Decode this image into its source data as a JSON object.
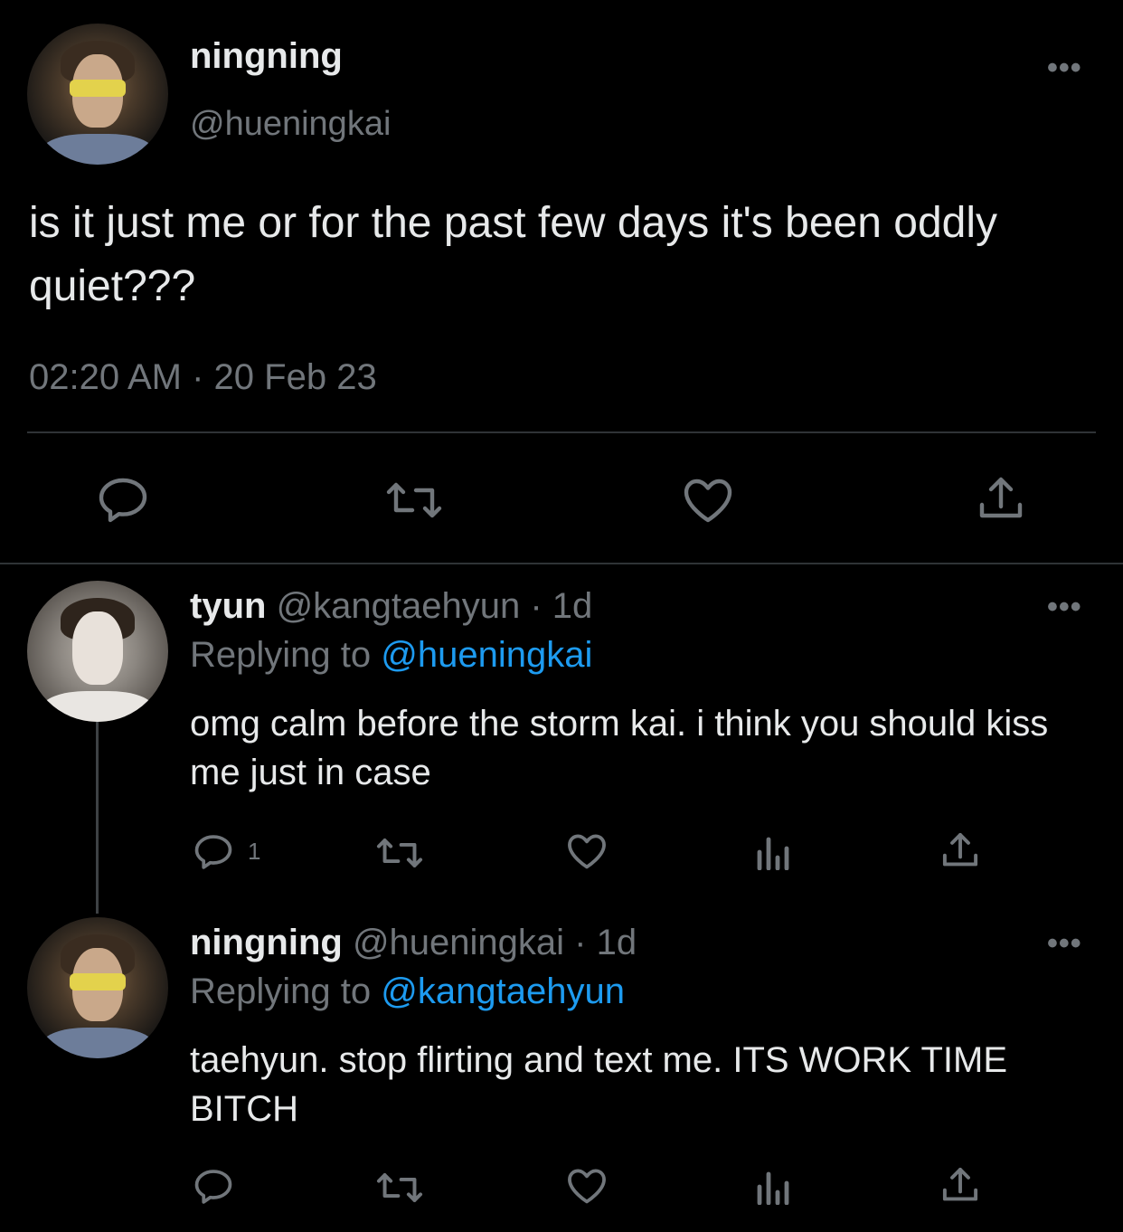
{
  "main_tweet": {
    "display_name": "ningning",
    "handle": "@hueningkai",
    "more": "•••",
    "text": "is it just me or for the past few days it's been oddly quiet???",
    "timestamp": "02:20 AM · 20 Feb 23"
  },
  "reply1": {
    "display_name": "tyun",
    "handle_time": "@kangtaehyun · 1d",
    "more": "•••",
    "replying_prefix": "Replying to",
    "replying_to": "@hueningkai",
    "text": "omg calm before the storm kai. i think you should kiss me just in case",
    "reply_count": "1"
  },
  "reply2": {
    "display_name": "ningning",
    "handle_time": "@hueningkai · 1d",
    "more": "•••",
    "replying_prefix": "Replying to",
    "replying_to": "@kangtaehyun",
    "text": "taehyun. stop flirting and text me. ITS WORK TIME BITCH"
  },
  "colors": {
    "background": "#000000",
    "text": "#e7e9ea",
    "muted": "#71767b",
    "link": "#1d9bf0"
  },
  "icons": [
    "reply-icon",
    "retweet-icon",
    "like-icon",
    "share-icon",
    "analytics-icon",
    "more-icon"
  ]
}
